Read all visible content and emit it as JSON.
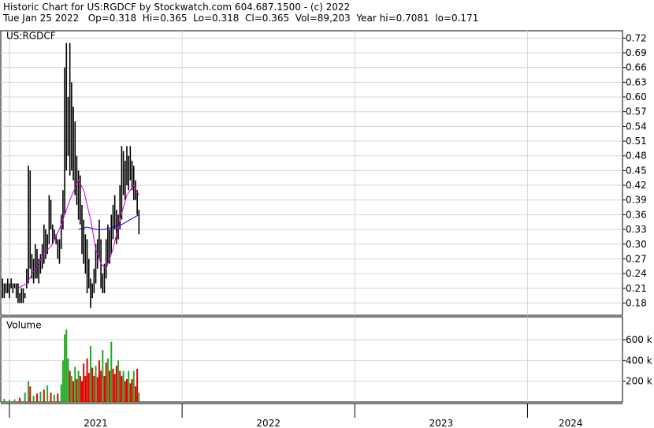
{
  "header": {
    "title": "Historic Chart for US:RGDCF by Stockwatch.com 604.687.1500 - (c) 2022",
    "quote": "Tue Jan 25 2022   Op=0.318  Hi=0.365  Lo=0.318  Cl=0.365  Vol=89,203  Year hi=0.7081  lo=0.171"
  },
  "chart_data": [
    {
      "type": "line",
      "title": "US:RGDCF",
      "y_scale": "linear",
      "ylim": [
        0.155,
        0.735
      ],
      "xlim": [
        2020.95,
        2024.55
      ],
      "y_ticks": [
        "0.72",
        "0.69",
        "0.66",
        "0.63",
        "0.60",
        "0.57",
        "0.54",
        "0.51",
        "0.48",
        "0.45",
        "0.42",
        "0.39",
        "0.36",
        "0.33",
        "0.30",
        "0.27",
        "0.24",
        "0.21",
        "0.18"
      ],
      "x_ticks": [
        {
          "label": "2021",
          "center": 2021.5
        },
        {
          "label": "2022",
          "center": 2022.5
        },
        {
          "label": "2023",
          "center": 2023.5
        },
        {
          "label": "2024",
          "center": 2024.25
        }
      ],
      "year_boundaries": [
        2021.0,
        2022.0,
        2023.0,
        2024.0
      ],
      "grid": true,
      "series": [
        {
          "style": "price-bars",
          "color": "#000000",
          "points": [
            [
              2020.96,
              0.19,
              0.23
            ],
            [
              2020.97,
              0.19,
              0.22
            ],
            [
              2020.98,
              0.2,
              0.22
            ],
            [
              2020.99,
              0.2,
              0.23
            ],
            [
              2021.0,
              0.19,
              0.22
            ],
            [
              2021.01,
              0.21,
              0.23
            ],
            [
              2021.02,
              0.2,
              0.22
            ],
            [
              2021.03,
              0.21,
              0.22
            ],
            [
              2021.04,
              0.19,
              0.22
            ],
            [
              2021.05,
              0.18,
              0.22
            ],
            [
              2021.06,
              0.18,
              0.2
            ],
            [
              2021.07,
              0.18,
              0.21
            ],
            [
              2021.08,
              0.18,
              0.21
            ],
            [
              2021.09,
              0.19,
              0.2
            ],
            [
              2021.1,
              0.21,
              0.25
            ],
            [
              2021.11,
              0.22,
              0.46
            ],
            [
              2021.12,
              0.25,
              0.45
            ],
            [
              2021.13,
              0.23,
              0.28
            ],
            [
              2021.14,
              0.22,
              0.27
            ],
            [
              2021.15,
              0.23,
              0.3
            ],
            [
              2021.16,
              0.23,
              0.29
            ],
            [
              2021.17,
              0.22,
              0.27
            ],
            [
              2021.18,
              0.24,
              0.28
            ],
            [
              2021.19,
              0.25,
              0.3
            ],
            [
              2021.2,
              0.26,
              0.34
            ],
            [
              2021.21,
              0.27,
              0.33
            ],
            [
              2021.22,
              0.28,
              0.32
            ],
            [
              2021.23,
              0.3,
              0.4
            ],
            [
              2021.24,
              0.33,
              0.39
            ],
            [
              2021.25,
              0.3,
              0.34
            ],
            [
              2021.26,
              0.31,
              0.33
            ],
            [
              2021.27,
              0.3,
              0.32
            ],
            [
              2021.28,
              0.27,
              0.31
            ],
            [
              2021.29,
              0.26,
              0.31
            ],
            [
              2021.3,
              0.29,
              0.36
            ],
            [
              2021.31,
              0.33,
              0.41
            ],
            [
              2021.32,
              0.36,
              0.66
            ],
            [
              2021.33,
              0.45,
              0.71
            ],
            [
              2021.34,
              0.48,
              0.6
            ],
            [
              2021.35,
              0.44,
              0.71
            ],
            [
              2021.36,
              0.45,
              0.63
            ],
            [
              2021.37,
              0.43,
              0.58
            ],
            [
              2021.38,
              0.4,
              0.55
            ],
            [
              2021.39,
              0.38,
              0.48
            ],
            [
              2021.4,
              0.35,
              0.45
            ],
            [
              2021.41,
              0.34,
              0.44
            ],
            [
              2021.42,
              0.28,
              0.38
            ],
            [
              2021.43,
              0.26,
              0.35
            ],
            [
              2021.44,
              0.24,
              0.32
            ],
            [
              2021.45,
              0.2,
              0.31
            ],
            [
              2021.46,
              0.21,
              0.27
            ],
            [
              2021.47,
              0.17,
              0.23
            ],
            [
              2021.48,
              0.19,
              0.22
            ],
            [
              2021.49,
              0.2,
              0.25
            ],
            [
              2021.5,
              0.22,
              0.3
            ],
            [
              2021.51,
              0.25,
              0.31
            ],
            [
              2021.52,
              0.27,
              0.35
            ],
            [
              2021.53,
              0.21,
              0.31
            ],
            [
              2021.54,
              0.2,
              0.24
            ],
            [
              2021.55,
              0.2,
              0.26
            ],
            [
              2021.56,
              0.23,
              0.31
            ],
            [
              2021.57,
              0.26,
              0.34
            ],
            [
              2021.58,
              0.26,
              0.33
            ],
            [
              2021.59,
              0.28,
              0.36
            ],
            [
              2021.6,
              0.31,
              0.38
            ],
            [
              2021.61,
              0.33,
              0.4
            ],
            [
              2021.62,
              0.3,
              0.37
            ],
            [
              2021.63,
              0.31,
              0.36
            ],
            [
              2021.64,
              0.33,
              0.42
            ],
            [
              2021.65,
              0.35,
              0.5
            ],
            [
              2021.66,
              0.4,
              0.49
            ],
            [
              2021.67,
              0.39,
              0.47
            ],
            [
              2021.68,
              0.42,
              0.5
            ],
            [
              2021.69,
              0.41,
              0.48
            ],
            [
              2021.7,
              0.43,
              0.5
            ],
            [
              2021.71,
              0.41,
              0.47
            ],
            [
              2021.72,
              0.39,
              0.46
            ],
            [
              2021.73,
              0.39,
              0.43
            ],
            [
              2021.74,
              0.36,
              0.41
            ],
            [
              2021.75,
              0.32,
              0.37
            ]
          ]
        },
        {
          "name": "",
          "style": "moving-average",
          "color": "#cc00cc",
          "points": [
            [
              2021.05,
              0.21
            ],
            [
              2021.1,
              0.22
            ],
            [
              2021.15,
              0.25
            ],
            [
              2021.2,
              0.28
            ],
            [
              2021.25,
              0.3
            ],
            [
              2021.3,
              0.34
            ],
            [
              2021.35,
              0.39
            ],
            [
              2021.4,
              0.43
            ],
            [
              2021.43,
              0.41
            ],
            [
              2021.47,
              0.35
            ],
            [
              2021.5,
              0.29
            ],
            [
              2021.53,
              0.26
            ],
            [
              2021.56,
              0.25
            ],
            [
              2021.6,
              0.29
            ],
            [
              2021.64,
              0.35
            ],
            [
              2021.68,
              0.4
            ],
            [
              2021.72,
              0.42
            ],
            [
              2021.75,
              0.4
            ]
          ]
        },
        {
          "name": "",
          "style": "moving-average",
          "color": "#0000cc",
          "points": [
            [
              2021.4,
              0.33
            ],
            [
              2021.45,
              0.335
            ],
            [
              2021.5,
              0.33
            ],
            [
              2021.55,
              0.33
            ],
            [
              2021.6,
              0.335
            ],
            [
              2021.65,
              0.34
            ],
            [
              2021.7,
              0.35
            ],
            [
              2021.75,
              0.36
            ]
          ]
        }
      ]
    },
    {
      "type": "bar",
      "title": "Volume",
      "ylim": [
        0,
        820000
      ],
      "y_ticks": [
        {
          "label": "600 k",
          "value": 600000
        },
        {
          "label": "400 k",
          "value": 400000
        },
        {
          "label": "200 k",
          "value": 200000
        }
      ],
      "up_color": "#22aa22",
      "down_color": "#dd0000",
      "values": [
        [
          2020.97,
          30000,
          1
        ],
        [
          2021.0,
          20000,
          1
        ],
        [
          2021.03,
          25000,
          1
        ],
        [
          2021.06,
          40000,
          0
        ],
        [
          2021.09,
          90000,
          1
        ],
        [
          2021.11,
          200000,
          1
        ],
        [
          2021.12,
          150000,
          0
        ],
        [
          2021.14,
          60000,
          1
        ],
        [
          2021.16,
          80000,
          0
        ],
        [
          2021.18,
          100000,
          1
        ],
        [
          2021.2,
          120000,
          0
        ],
        [
          2021.22,
          160000,
          1
        ],
        [
          2021.24,
          90000,
          0
        ],
        [
          2021.26,
          70000,
          1
        ],
        [
          2021.28,
          80000,
          0
        ],
        [
          2021.3,
          170000,
          1
        ],
        [
          2021.31,
          400000,
          1
        ],
        [
          2021.32,
          650000,
          1
        ],
        [
          2021.33,
          700000,
          1
        ],
        [
          2021.34,
          420000,
          1
        ],
        [
          2021.35,
          300000,
          0
        ],
        [
          2021.36,
          250000,
          1
        ],
        [
          2021.37,
          200000,
          0
        ],
        [
          2021.38,
          340000,
          1
        ],
        [
          2021.39,
          220000,
          0
        ],
        [
          2021.4,
          300000,
          1
        ],
        [
          2021.41,
          250000,
          0
        ],
        [
          2021.42,
          200000,
          0
        ],
        [
          2021.43,
          370000,
          0
        ],
        [
          2021.44,
          250000,
          0
        ],
        [
          2021.45,
          420000,
          0
        ],
        [
          2021.46,
          280000,
          0
        ],
        [
          2021.47,
          540000,
          1
        ],
        [
          2021.48,
          330000,
          0
        ],
        [
          2021.49,
          250000,
          0
        ],
        [
          2021.5,
          350000,
          1
        ],
        [
          2021.51,
          240000,
          0
        ],
        [
          2021.52,
          400000,
          0
        ],
        [
          2021.53,
          300000,
          0
        ],
        [
          2021.54,
          500000,
          1
        ],
        [
          2021.55,
          250000,
          0
        ],
        [
          2021.56,
          380000,
          0
        ],
        [
          2021.57,
          420000,
          1
        ],
        [
          2021.58,
          300000,
          0
        ],
        [
          2021.59,
          580000,
          1
        ],
        [
          2021.6,
          320000,
          0
        ],
        [
          2021.61,
          270000,
          0
        ],
        [
          2021.62,
          350000,
          0
        ],
        [
          2021.63,
          400000,
          1
        ],
        [
          2021.64,
          300000,
          0
        ],
        [
          2021.65,
          250000,
          0
        ],
        [
          2021.66,
          300000,
          1
        ],
        [
          2021.67,
          200000,
          0
        ],
        [
          2021.68,
          220000,
          0
        ],
        [
          2021.69,
          300000,
          1
        ],
        [
          2021.7,
          180000,
          0
        ],
        [
          2021.71,
          220000,
          0
        ],
        [
          2021.72,
          300000,
          1
        ],
        [
          2021.73,
          150000,
          0
        ],
        [
          2021.74,
          320000,
          0
        ],
        [
          2021.75,
          90000,
          1
        ]
      ]
    }
  ]
}
